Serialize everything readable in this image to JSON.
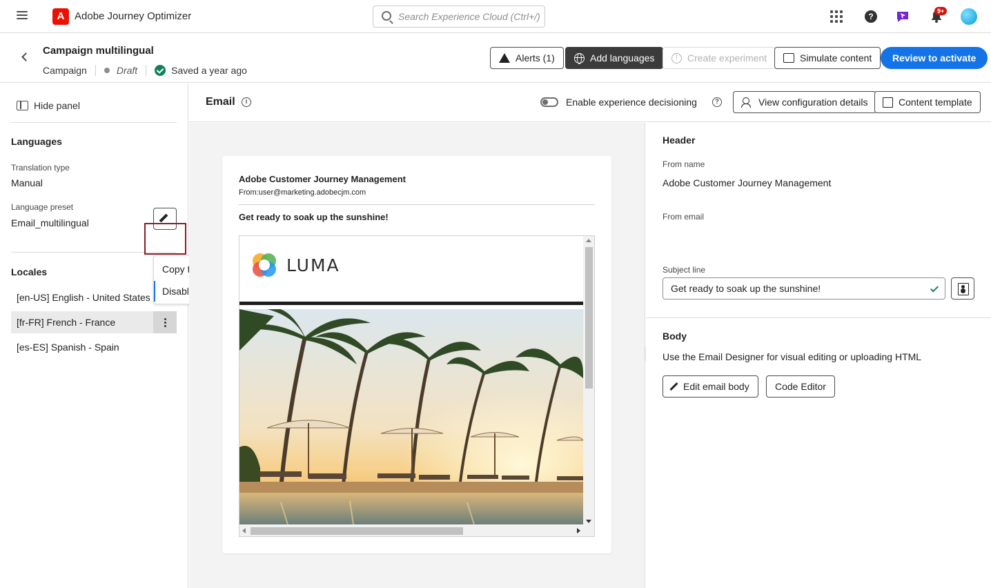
{
  "app": {
    "title": "Adobe Journey Optimizer",
    "logo_letter": "A",
    "search_placeholder": "Search Experience Cloud (Ctrl+/)",
    "notifications_badge": "9+"
  },
  "campaign": {
    "title": "Campaign multilingual",
    "type": "Campaign",
    "status": "Draft",
    "saved": "Saved a year ago"
  },
  "header_buttons": {
    "alerts": "Alerts (1)",
    "add_languages": "Add languages",
    "create_experiment": "Create experiment",
    "simulate_content": "Simulate content",
    "review_to_activate": "Review to activate"
  },
  "left_panel": {
    "hide_panel": "Hide panel",
    "languages_heading": "Languages",
    "translation_type_label": "Translation type",
    "translation_type_value": "Manual",
    "language_preset_label": "Language preset",
    "language_preset_value": "Email_multilingual",
    "locales_heading": "Locales",
    "locales": [
      {
        "label": "[en-US] English - United States"
      },
      {
        "label": "[fr-FR] French - France"
      },
      {
        "label": "[es-ES] Spanish - Spain"
      }
    ],
    "context_menu": [
      {
        "label": "Copy to other locales"
      },
      {
        "label": "Disable locale"
      }
    ]
  },
  "email_toolbar": {
    "title": "Email",
    "toggle_label": "Enable experience decisioning",
    "view_config": "View configuration details",
    "content_template": "Content template"
  },
  "preview": {
    "sender_name": "Adobe Customer Journey Management",
    "sender_email": "From:user@marketing.adobecjm.com",
    "subject": "Get ready to soak up the sunshine!",
    "brand": "LUMA"
  },
  "properties": {
    "header_heading": "Header",
    "from_name_label": "From name",
    "from_name_value": "Adobe Customer Journey Management",
    "from_email_label": "From email",
    "subject_line_label": "Subject line",
    "subject_line_value": "Get ready to soak up the sunshine!",
    "body_heading": "Body",
    "body_description": "Use the Email Designer for visual editing or uploading HTML",
    "edit_email_body": "Edit email body",
    "code_editor": "Code Editor"
  },
  "colors": {
    "accent": "#1473e6",
    "adobe_red": "#eb1000",
    "success": "#12805c",
    "focus_outline": "#8a1a24"
  }
}
